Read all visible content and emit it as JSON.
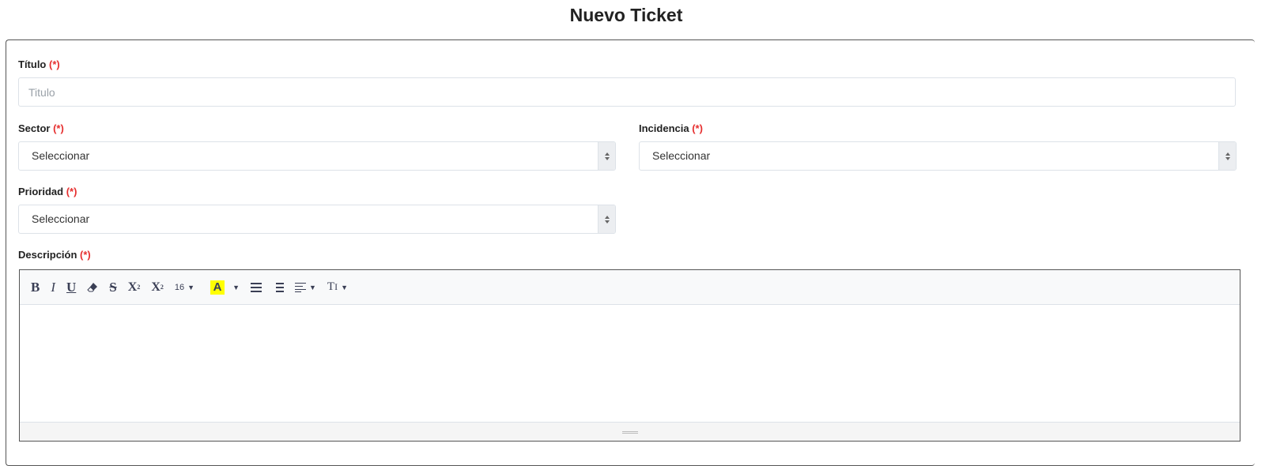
{
  "page": {
    "title": "Nuevo Ticket"
  },
  "form": {
    "required_marker": "(*)",
    "titulo": {
      "label": "Título",
      "placeholder": "Titulo",
      "value": ""
    },
    "sector": {
      "label": "Sector",
      "selected": "Seleccionar"
    },
    "incidencia": {
      "label": "Incidencia",
      "selected": "Seleccionar"
    },
    "prioridad": {
      "label": "Prioridad",
      "selected": "Seleccionar"
    },
    "descripcion": {
      "label": "Descripción",
      "value": ""
    }
  },
  "editor": {
    "toolbar": {
      "bold": "B",
      "italic": "I",
      "underline": "U",
      "strikethrough": "S",
      "superscript": "X",
      "subscript": "X",
      "font_size": "16",
      "highlight": "A",
      "text_style": "T"
    }
  },
  "colors": {
    "required": "#e62e2e",
    "highlight": "#ffff00",
    "border": "#dde2e8"
  }
}
